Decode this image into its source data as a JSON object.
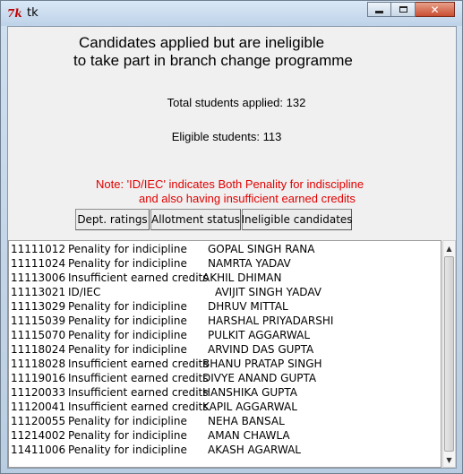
{
  "window": {
    "title": "tk",
    "icon": "tk-feather-icon"
  },
  "header": {
    "line1": "Candidates applied but are ineligible",
    "line2": "to take part in branch change programme"
  },
  "stats": {
    "total": "Total students applied: 132",
    "eligible": "Eligible students: 113"
  },
  "note": {
    "line1": "Note: 'ID/IEC' indicates Both Penality for indiscipline",
    "line2": "and also having insufficient earned credits"
  },
  "buttons": {
    "dept": "Dept. ratings",
    "allotment": "Allotment status",
    "ineligible": "Ineligible candidates"
  },
  "rows": [
    {
      "id": "11111012",
      "reason": "Penality for indicipline",
      "name": "GOPAL SINGH RANA"
    },
    {
      "id": "11111024",
      "reason": "Penality for indicipline",
      "name": "NAMRTA YADAV"
    },
    {
      "id": "11113006",
      "reason": "Insufficient earned credits",
      "name": "AKHIL DHIMAN"
    },
    {
      "id": "11113021",
      "reason": "ID/IEC",
      "name": "AVIJIT SINGH YADAV"
    },
    {
      "id": "11113029",
      "reason": "Penality for indicipline",
      "name": "DHRUV MITTAL"
    },
    {
      "id": "11115039",
      "reason": "Penality for indicipline",
      "name": "HARSHAL PRIYADARSHI"
    },
    {
      "id": "11115070",
      "reason": "Penality for indicipline",
      "name": "PULKIT AGGARWAL"
    },
    {
      "id": "11118024",
      "reason": "Penality for indicipline",
      "name": "ARVIND DAS GUPTA"
    },
    {
      "id": "11118028",
      "reason": "Insufficient earned credits",
      "name": "BHANU PRATAP SINGH"
    },
    {
      "id": "11119016",
      "reason": "Insufficient earned credits",
      "name": "DIVYE ANAND GUPTA"
    },
    {
      "id": "11120033",
      "reason": "Insufficient earned credits",
      "name": "HANSHIKA GUPTA"
    },
    {
      "id": "11120041",
      "reason": "Insufficient earned credits",
      "name": "KAPIL AGGARWAL"
    },
    {
      "id": "11120055",
      "reason": "Penality for indicipline",
      "name": "NEHA BANSAL"
    },
    {
      "id": "11214002",
      "reason": "Penality for indicipline",
      "name": "AMAN CHAWLA"
    },
    {
      "id": "11411006",
      "reason": "Penality for indicipline",
      "name": "AKASH AGARWAL"
    }
  ],
  "colors": {
    "note": "#e00000",
    "client_bg": "#f0f0f0",
    "list_bg": "#ffffff"
  }
}
